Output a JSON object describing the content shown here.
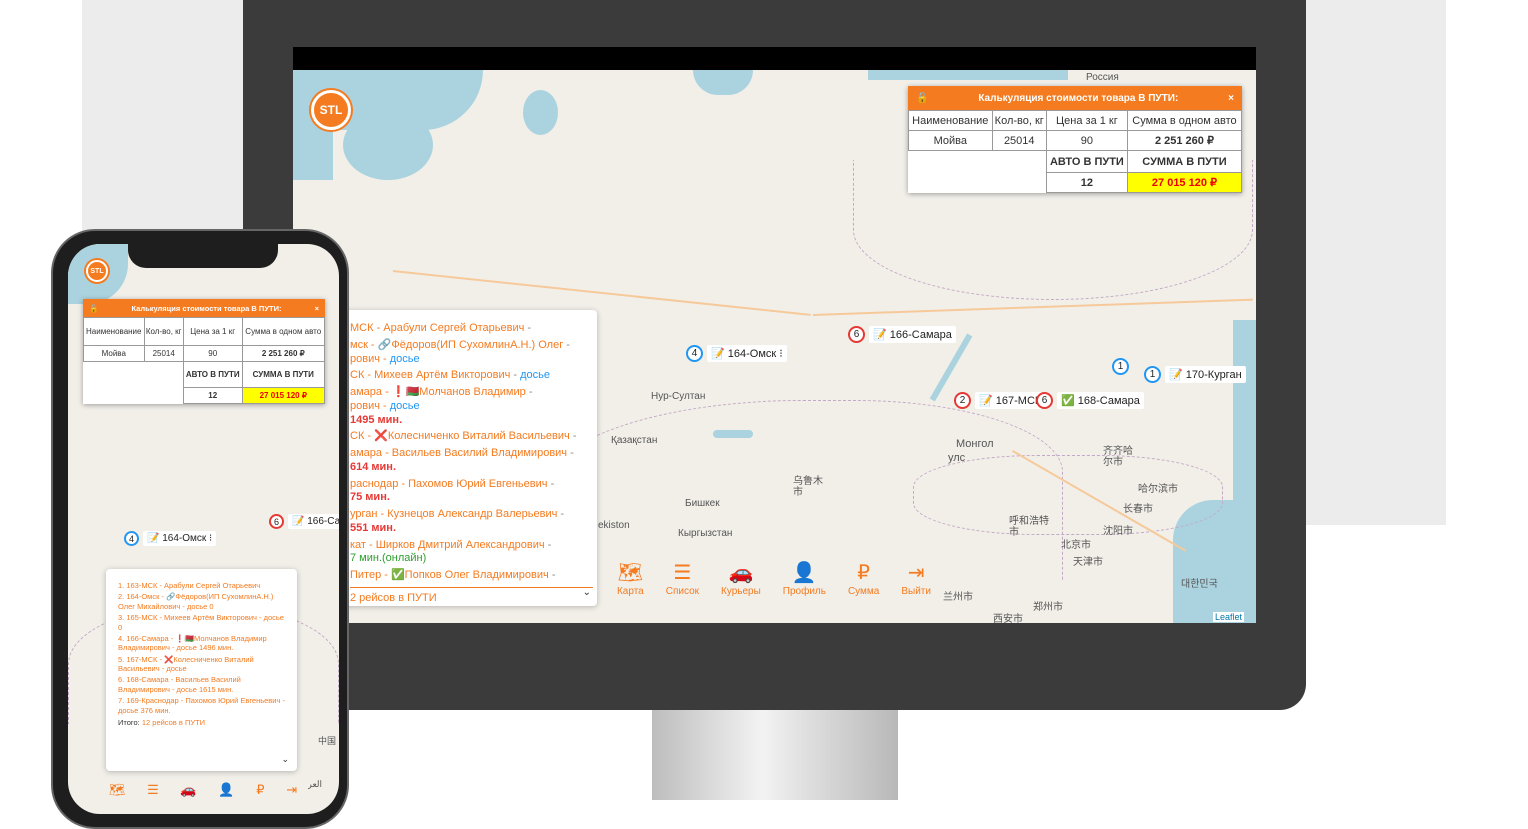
{
  "calc": {
    "title": "Калькуляция стоимости товара В ПУТИ:",
    "close": "×",
    "headers": [
      "Наименование",
      "Кол-во, кг",
      "Цена за 1 кг",
      "Сумма в одном авто"
    ],
    "row": [
      "Мойва",
      "25014",
      "90",
      "2 251 260 ₽"
    ],
    "summary_headers": [
      "АВТО В ПУТИ",
      "СУММА В ПУТИ"
    ],
    "summary_values": [
      "12",
      "27 015 120 ₽"
    ],
    "sum_color": "#ffff00"
  },
  "phone_calc_headers": [
    "Наименование",
    "Кол-во, кг",
    "Цена за 1 кг",
    "Сумма в одном авто"
  ],
  "logo_text": "STL",
  "map_labels": {
    "russia": "Россия",
    "nursultan": "Нур-Султан",
    "kazakhstan": "Қазақстан",
    "bishkek": "Бишкек",
    "kyrgyzstan": "Кыргызстан",
    "mongolia": "Монгол",
    "mongolia2": "улс",
    "urumqi": "乌鲁木\n市",
    "tashkent": "ekiston",
    "china": "中国",
    "qiqihar": "齐齐哈\n尔市",
    "harbin": "哈尔滨市",
    "changchun": "长春市",
    "hohhot": "呼和浩特\n市",
    "shenyang": "沈阳市",
    "beijing": "北京市",
    "tianjin": "天津市",
    "xian": "西安市",
    "zhengzhou": "郑州市",
    "lanzhou": "兰州市",
    "korea": "대한민국",
    "attribution": "Leaflet",
    "iraq": "العراق"
  },
  "markers": [
    {
      "num": "4",
      "icon": "📝",
      "label": "164-Омск",
      "color": "blue"
    },
    {
      "num": "6",
      "icon": "📝",
      "label": "166-Самара",
      "color": "red"
    },
    {
      "num": "2",
      "icon": "📝",
      "label": "167-МСК",
      "color": "red"
    },
    {
      "num": "6",
      "icon": "✅",
      "label": "168-Самара",
      "color": "red"
    },
    {
      "num": "1",
      "icon": "📝",
      "label": "170-Курган",
      "color": "blue"
    },
    {
      "num": "1",
      "icon": "",
      "label": "",
      "color": "blue"
    }
  ],
  "phone_markers": [
    {
      "num": "4",
      "icon": "📝",
      "label": "164-Омск"
    },
    {
      "num": "6",
      "icon": "📝",
      "label": "166-Са"
    }
  ],
  "desk_list": {
    "items": [
      {
        "a": "МСК - Арабули Сергей Отарьевич",
        "b": "",
        "d": "",
        "m": ""
      },
      {
        "a": "мск - 🔗Фёдоров(ИП СухомлинА.Н.) Олег",
        "b": "рович",
        "d": "досье",
        "m": ""
      },
      {
        "a": "СК - Михеев Артём Викторович",
        "b": "",
        "d": "досье",
        "m": ""
      },
      {
        "a": "амара - ❗🇧🇾Молчанов Владимир",
        "b": "рович",
        "d": "досье",
        "m": "1495 мин."
      },
      {
        "a": "СК - ❌Колесниченко Виталий Васильевич",
        "b": "",
        "d": "",
        "m": ""
      },
      {
        "a": "амара - Васильев Василий Владимирович",
        "b": "",
        "d": "",
        "m": "614 мин."
      },
      {
        "a": "раснодар - Пахомов Юрий Евгеньевич",
        "b": "",
        "d": "",
        "m": "75 мин."
      },
      {
        "a": "урган - Кузнецов Александр Валерьевич",
        "b": "",
        "d": "",
        "m": "551 мин."
      },
      {
        "a": "кат - Ширков Дмитрий Александрович",
        "b": "",
        "d": "",
        "m": "7 мин.(онлайн)"
      },
      {
        "a": "Питер - ✅Попков Олег Владимирович",
        "b": "",
        "d": "",
        "m": ""
      }
    ],
    "total": "2 рейсов в ПУТИ"
  },
  "phone_list": {
    "items": [
      "1. 163-МСК - Арабули Сергей Отарьевич",
      "2. 164-Омск - 🔗Фёдоров(ИП СухомлинА.Н.) Олег Михайлович - досье 0",
      "3. 165-МСК - Михеев Артём Викторович - досье 0",
      "4. 166-Самара - ❗🇧🇾Молчанов Владимир Владимирович - досье 1496 мин.",
      "5. 167-МСК - ❌Колесниченко Виталий Васильевич - досье",
      "6. 168-Самара - Васильев Василий Владимирович - досье 1615 мин.",
      "7. 169-Краснодар - Пахомов Юрий Евгеньевич - досье 376 мин."
    ],
    "total_label": "Итого:",
    "total": "12 рейсов в ПУТИ"
  },
  "nav": [
    {
      "icon": "map-icon",
      "glyph": "🗺",
      "label": "Карта"
    },
    {
      "icon": "list-icon",
      "glyph": "☰",
      "label": "Список"
    },
    {
      "icon": "car-icon",
      "glyph": "🚗",
      "label": "Курьеры"
    },
    {
      "icon": "user-icon",
      "glyph": "👤",
      "label": "Профиль"
    },
    {
      "icon": "ruble-icon",
      "glyph": "₽",
      "label": "Сумма"
    },
    {
      "icon": "logout-icon",
      "glyph": "⇥",
      "label": "Выйти"
    }
  ],
  "colors": {
    "accent": "#f47b20",
    "link": "#2196f3",
    "alert": "#e53935"
  }
}
